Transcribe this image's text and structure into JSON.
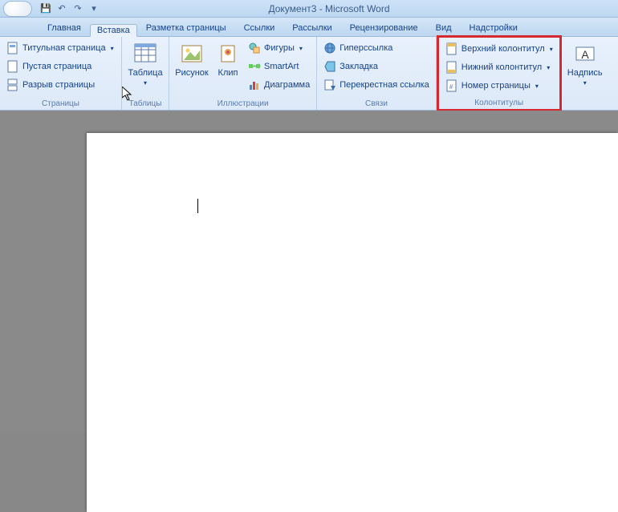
{
  "title": "Документ3 - Microsoft Word",
  "qat": {
    "save": "💾",
    "undo": "↶",
    "redo": "↷"
  },
  "tabs": {
    "home": "Главная",
    "insert": "Вставка",
    "page_layout": "Разметка страницы",
    "references": "Ссылки",
    "mailings": "Рассылки",
    "review": "Рецензирование",
    "view": "Вид",
    "addins": "Надстройки"
  },
  "groups": {
    "pages": {
      "label": "Страницы",
      "cover_page": "Титульная страница",
      "blank_page": "Пустая страница",
      "page_break": "Разрыв страницы"
    },
    "tables": {
      "label": "Таблицы",
      "table": "Таблица"
    },
    "illustrations": {
      "label": "Иллюстрации",
      "picture": "Рисунок",
      "clip": "Клип",
      "shapes": "Фигуры",
      "smartart": "SmartArt",
      "chart": "Диаграмма"
    },
    "links": {
      "label": "Связи",
      "hyperlink": "Гиперссылка",
      "bookmark": "Закладка",
      "cross_ref": "Перекрестная ссылка"
    },
    "header_footer": {
      "label": "Колонтитулы",
      "header": "Верхний колонтитул",
      "footer": "Нижний колонтитул",
      "page_number": "Номер страницы"
    },
    "text": {
      "label": "",
      "textbox": "Надпись"
    }
  }
}
